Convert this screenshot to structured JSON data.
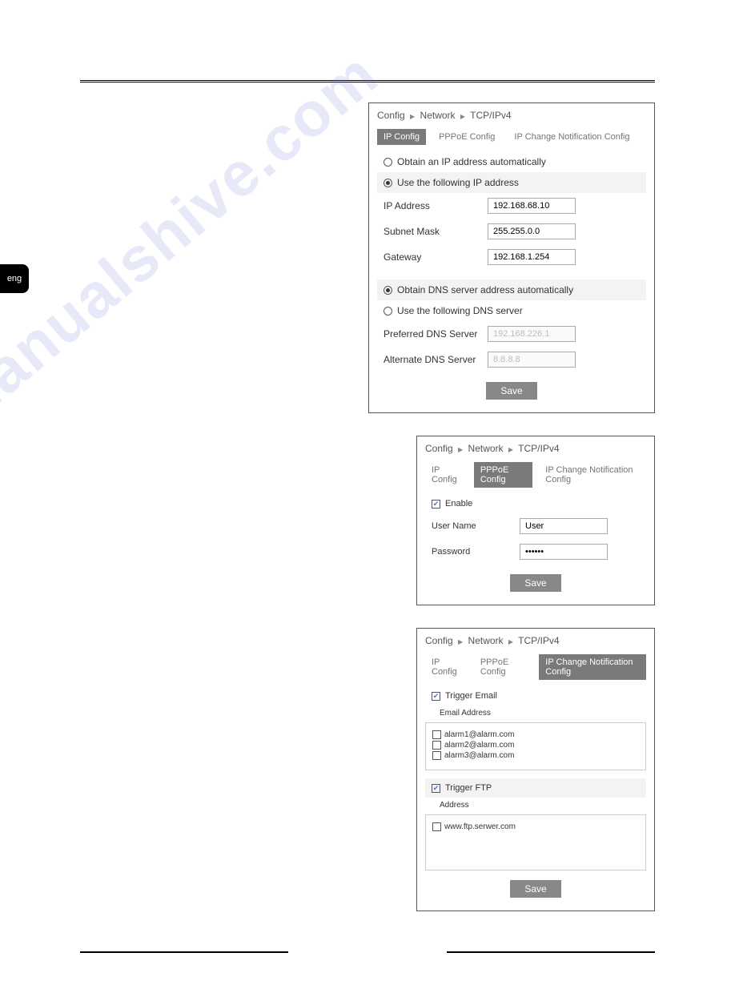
{
  "lang_tab": "eng",
  "breadcrumb": {
    "p1": "Config",
    "p2": "Network",
    "p3": "TCP/IPv4"
  },
  "tabs": {
    "ip": "IP Config",
    "pppoe": "PPPoE Config",
    "ipnotif": "IP Change Notification Config"
  },
  "panel1": {
    "opt_auto": "Obtain an IP address automatically",
    "opt_static": "Use the following IP address",
    "ip_label": "IP Address",
    "ip_value": "192.168.68.10",
    "mask_label": "Subnet Mask",
    "mask_value": "255.255.0.0",
    "gw_label": "Gateway",
    "gw_value": "192.168.1.254",
    "dns_auto": "Obtain DNS server address automatically",
    "dns_static": "Use the following DNS server",
    "pdns_label": "Preferred DNS Server",
    "pdns_value": "192.168.226.1",
    "adns_label": "Alternate DNS Server",
    "adns_value": "8.8.8.8",
    "save": "Save"
  },
  "panel2": {
    "enable": "Enable",
    "user_label": "User Name",
    "user_value": "User",
    "pass_label": "Password",
    "pass_value": "••••••",
    "save": "Save"
  },
  "panel3": {
    "trig_email": "Trigger Email",
    "email_label": "Email Address",
    "emails": {
      "e1": "alarm1@alarm.com",
      "e2": "alarm2@alarm.com",
      "e3": "alarm3@alarm.com"
    },
    "trig_ftp": "Trigger FTP",
    "addr_label": "Address",
    "ftp": "www.ftp.serwer.com",
    "save": "Save"
  },
  "watermark": "manualshive.com"
}
